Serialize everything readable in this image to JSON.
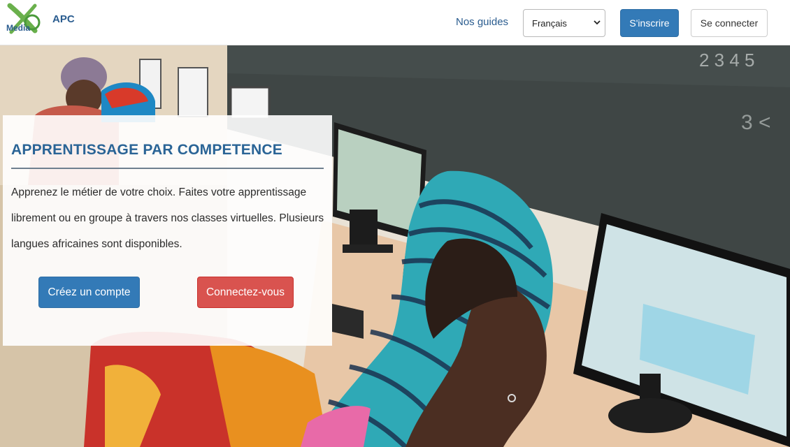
{
  "navbar": {
    "brand_logo_text": "Media",
    "brand_name": "APC",
    "guides_link": "Nos guides",
    "language_select": {
      "selected": "Français"
    },
    "signup_label": "S'inscrire",
    "login_label": "Se connecter"
  },
  "hero": {
    "title": "APPRENTISSAGE PAR COMPETENCE",
    "description": "Apprenez le métier de votre choix. Faites votre apprentissage librement ou en groupe à travers nos classes virtuelles. Plusieurs langues africaines sont disponibles.",
    "create_account_label": "Créez un compte",
    "connect_label": "Connectez-vous",
    "image_icon": "classroom-photo"
  },
  "colors": {
    "primary": "#337ab7",
    "danger": "#d9534f",
    "title": "#2a6496",
    "link": "#2a5c8f"
  }
}
